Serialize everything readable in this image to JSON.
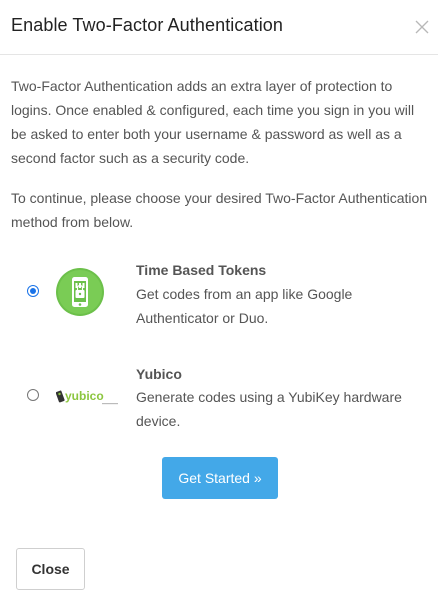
{
  "modal": {
    "title": "Enable Two-Factor Authentication",
    "close_icon": "close-icon",
    "intro": "Two-Factor Authentication adds an extra layer of protection to logins. Once enabled & configured, each time you sign in you will be asked to enter both your username & password as well as a second factor such as a security code.",
    "instructions": "To continue, please choose your desired Two-Factor Authentication method from below."
  },
  "options": [
    {
      "title": "Time Based Tokens",
      "description": "Get codes from an app like Google Authenticator or Duo.",
      "selected": true,
      "icon": "totp-phone-icon",
      "icon_color": "#6cc04a"
    },
    {
      "title": "Yubico",
      "description": "Generate codes using a YubiKey hardware device.",
      "selected": false,
      "icon": "yubico-logo",
      "logo_text": "yubico",
      "icon_color": "#8cc63f"
    }
  ],
  "actions": {
    "get_started": "Get Started »",
    "close": "Close"
  },
  "colors": {
    "primary_button": "#43a8e8",
    "radio_selected": "#1a73e8",
    "text": "#555555"
  }
}
